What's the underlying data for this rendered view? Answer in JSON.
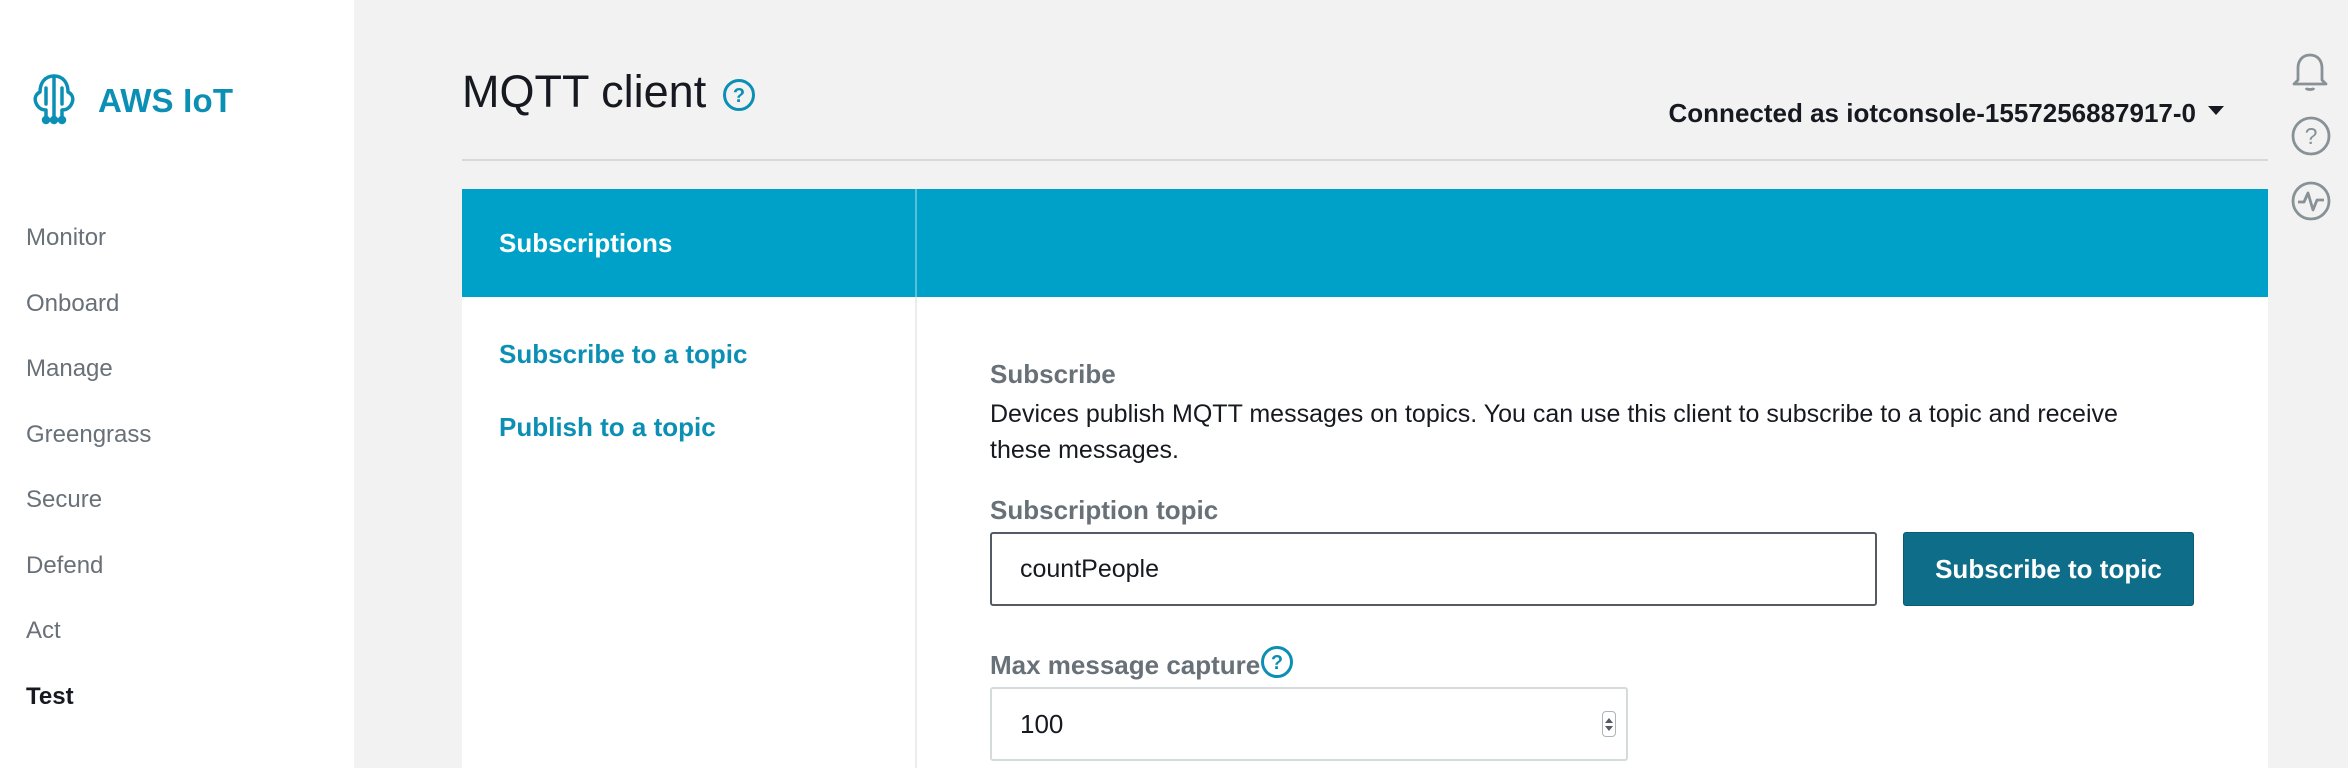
{
  "brand": {
    "name": "AWS IoT",
    "icon": "aws-iot-logo-icon"
  },
  "sidebar": {
    "items": [
      {
        "label": "Monitor",
        "active": false
      },
      {
        "label": "Onboard",
        "active": false
      },
      {
        "label": "Manage",
        "active": false
      },
      {
        "label": "Greengrass",
        "active": false
      },
      {
        "label": "Secure",
        "active": false
      },
      {
        "label": "Defend",
        "active": false
      },
      {
        "label": "Act",
        "active": false
      },
      {
        "label": "Test",
        "active": true
      }
    ]
  },
  "header": {
    "title": "MQTT client",
    "help_icon": "help-circle-icon",
    "connected_label": "Connected as iotconsole-1557256887917-0"
  },
  "right_icons": [
    "bell-icon",
    "help-circle-icon",
    "activity-icon"
  ],
  "panel": {
    "heading": "Subscriptions",
    "links": [
      "Subscribe to a topic",
      "Publish to a topic"
    ],
    "subscribe": {
      "title": "Subscribe",
      "description": "Devices publish MQTT messages on topics. You can use this client to subscribe to a topic and receive these messages.",
      "topic_label": "Subscription topic",
      "topic_value": "countPeople",
      "button_label": "Subscribe to topic",
      "max_label": "Max message capture",
      "max_value": "100"
    }
  },
  "colors": {
    "accent": "#00a1c9",
    "link": "#0c8fb5",
    "button": "#0e6e8a",
    "muted_text": "#687078"
  }
}
